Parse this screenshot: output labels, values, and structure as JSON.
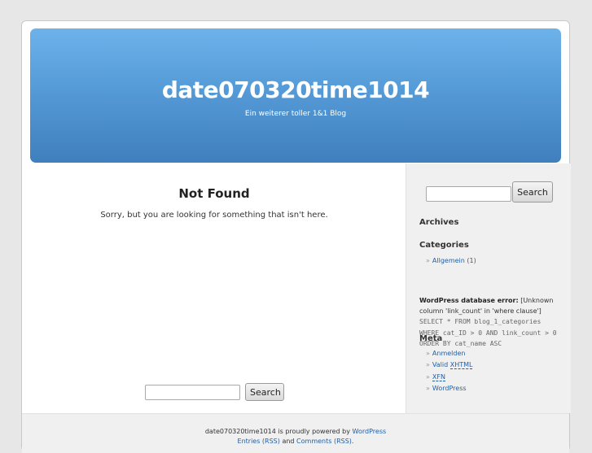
{
  "header": {
    "title": "date070320time1014",
    "description": "Ein weiterer toller 1&1 Blog"
  },
  "main": {
    "heading": "Not Found",
    "message": "Sorry, but you are looking for something that isn't here.",
    "search": {
      "value": "",
      "button_label": "Search"
    }
  },
  "sidebar": {
    "search": {
      "value": "",
      "button_label": "Search"
    },
    "archives_heading": "Archives",
    "categories_heading": "Categories",
    "categories": [
      {
        "label": "Allgemein",
        "count": "(1)"
      }
    ],
    "db_error": {
      "label": "WordPress database error:",
      "message": "[Unknown column 'link_count' in 'where clause']",
      "query": "SELECT * FROM blog_1_categories WHERE cat_ID > 0 AND link_count > 0 ORDER BY cat_name ASC"
    },
    "meta_heading": "Meta",
    "meta_items": [
      "Anmelden",
      "Valid",
      "XHTML",
      "XFN",
      "WordPress"
    ]
  },
  "footer": {
    "line1_prefix": "date070320time1014 is proudly powered by",
    "line1_link": "WordPress",
    "line2_entries": "Entries (RSS)",
    "line2_and": "and",
    "line2_comments": "Comments (RSS)",
    "line2_end": "."
  },
  "colors": {
    "header_top": "#6db2ea",
    "header_bottom": "#3f7fbd",
    "link": "#1f5fa6",
    "background": "#e7e7e7"
  }
}
